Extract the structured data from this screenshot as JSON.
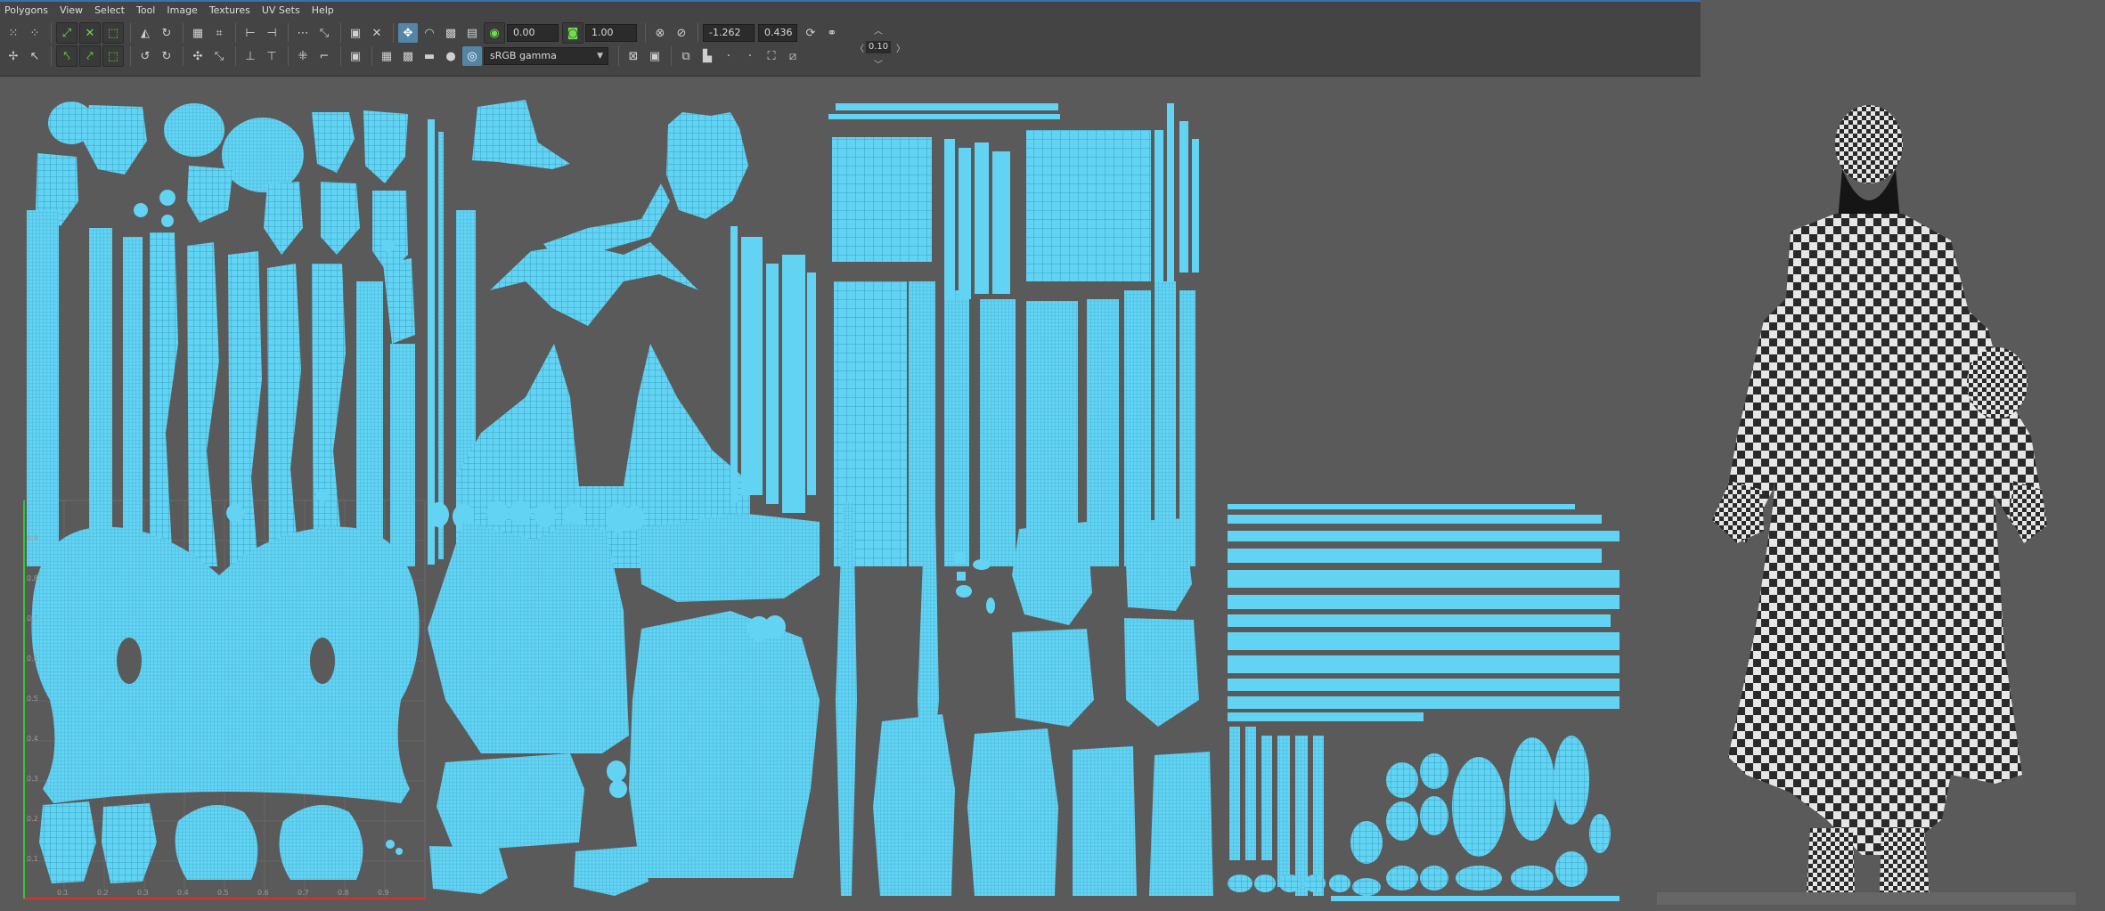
{
  "menu": [
    "Polygons",
    "View",
    "Select",
    "Tool",
    "Image",
    "Textures",
    "UV Sets",
    "Help"
  ],
  "toolbar": {
    "field_a": "0.00",
    "field_b": "1.00",
    "color_space": "sRGB gamma",
    "coord_u": "-1.262",
    "coord_v": "0.436",
    "step_value": "0.10"
  },
  "uv_grid_ticks": [
    "0.1",
    "0.2",
    "0.3",
    "0.4",
    "0.5",
    "0.6",
    "0.7",
    "0.8",
    "0.9"
  ],
  "colors": {
    "background": "#5a5a5a",
    "panel": "#444444",
    "uv_fill": "#63d3f3",
    "uv_wire": "#2b97b8",
    "axis_u": "#d9302c",
    "axis_v": "#3ac23a",
    "checker_dark": "#2a2a2a",
    "checker_light": "#e6e6e6"
  }
}
